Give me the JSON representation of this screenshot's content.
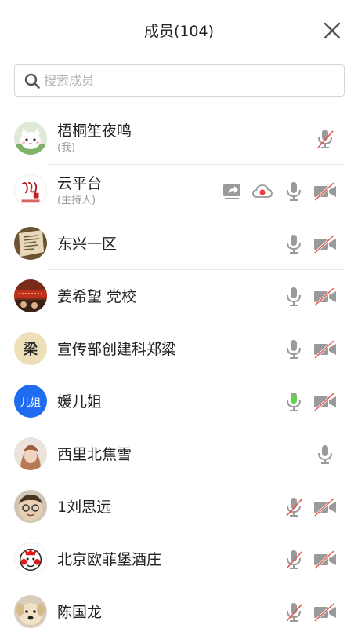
{
  "header": {
    "title": "成员(104)"
  },
  "search": {
    "placeholder": "搜索成员"
  },
  "colors": {
    "icon_gray": "#9a9a9a",
    "muted_red": "#e8544e",
    "speaking_green": "#5fd34a",
    "avatar_blue": "#1f6cf2",
    "recording_red": "#f03b3b"
  },
  "members": [
    {
      "name": "梧桐笙夜鸣",
      "sub": "(我)",
      "avatar": "cat-avatar",
      "mic": "muted",
      "camera": "none"
    },
    {
      "name": "云平台",
      "sub": "(主持人)",
      "avatar": "calligraphy-logo-avatar",
      "mic": "on",
      "camera": "off",
      "share": true,
      "recording": true
    },
    {
      "name": "东兴一区",
      "sub": "",
      "avatar": "document-photo-avatar",
      "mic": "on",
      "camera": "off"
    },
    {
      "name": "姜希望 党校",
      "sub": "",
      "avatar": "banner-photo-avatar",
      "mic": "on",
      "camera": "off"
    },
    {
      "name": "宣传部创建科郑粱",
      "sub": "",
      "avatar": "character-liang-avatar",
      "avatar_text": "梁",
      "mic": "on",
      "camera": "off"
    },
    {
      "name": "媛儿姐",
      "sub": "",
      "avatar": "initials-avatar",
      "avatar_text": "儿姐",
      "mic": "speaking",
      "camera": "off"
    },
    {
      "name": "西里北焦雪",
      "sub": "",
      "avatar": "portrait-avatar",
      "mic": "on",
      "camera": "none"
    },
    {
      "name": "1刘思远",
      "sub": "",
      "avatar": "kid-photo-avatar",
      "mic": "muted",
      "camera": "off"
    },
    {
      "name": "北京欧菲堡酒庄",
      "sub": "",
      "avatar": "cartoon-avatar",
      "mic": "muted",
      "camera": "off"
    },
    {
      "name": "陈国龙",
      "sub": "",
      "avatar": "dog-avatar",
      "mic": "muted",
      "camera": "off"
    }
  ]
}
